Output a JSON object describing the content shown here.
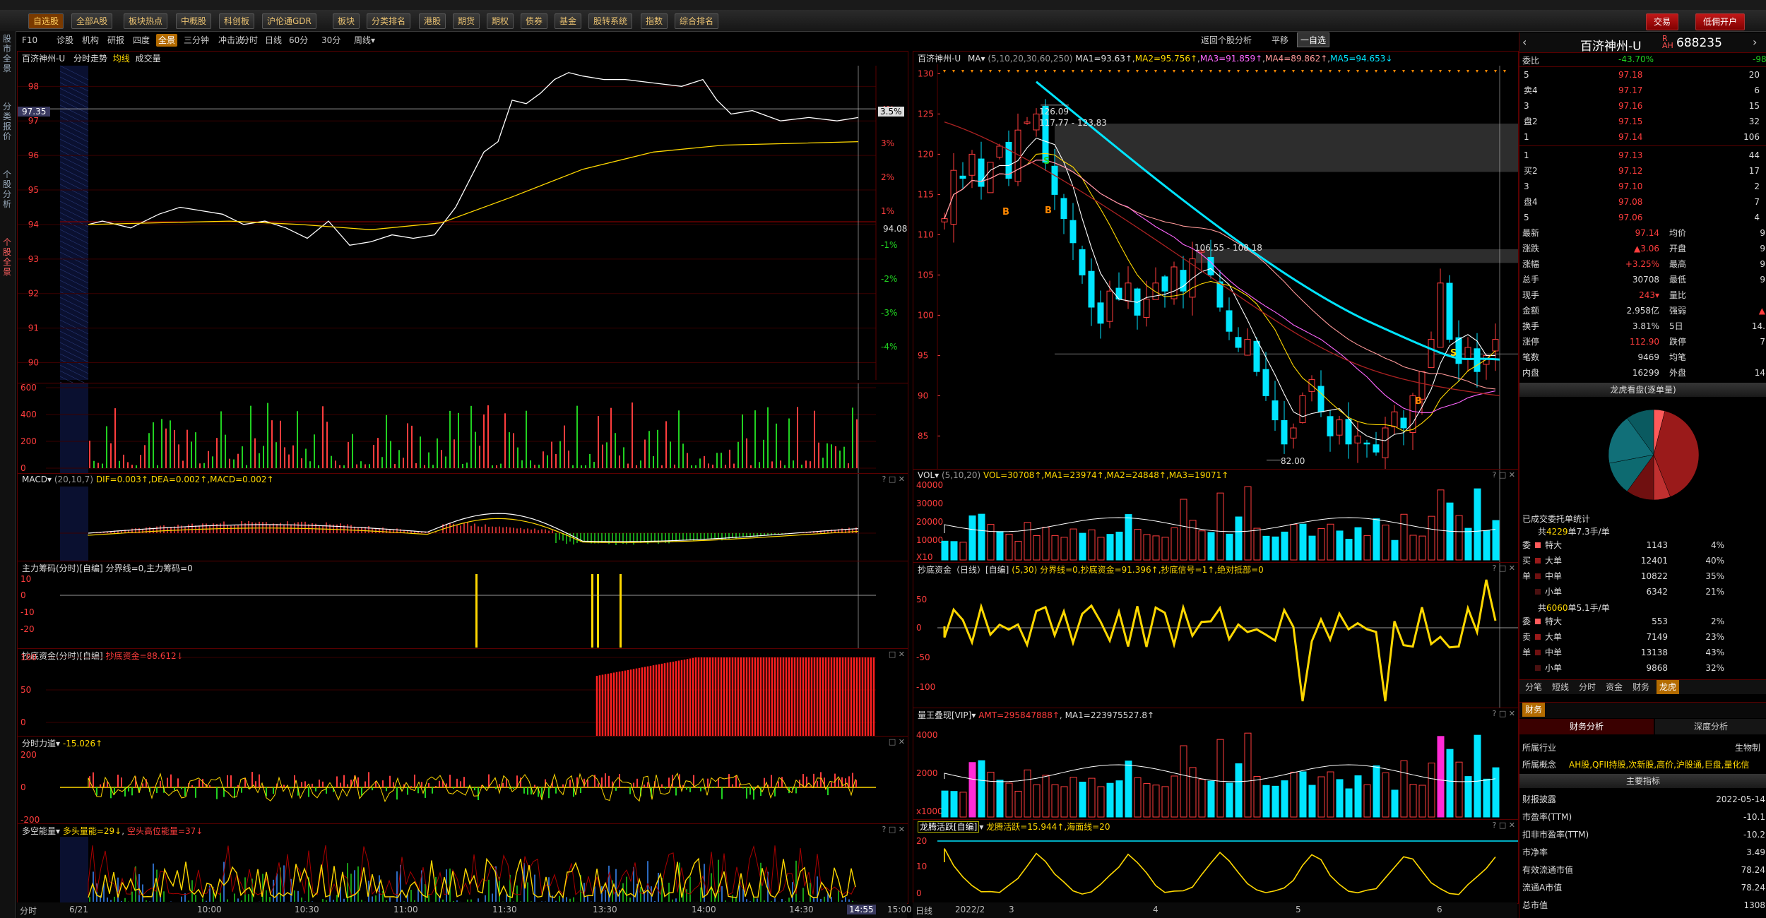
{
  "toolbar": {
    "items": [
      "自选股",
      "全部A股",
      "板块热点",
      "中概股",
      "科创板",
      "沪伦通GDR",
      "板块",
      "分类排名",
      "港股",
      "期货",
      "期权",
      "债券",
      "基金",
      "股转系统",
      "指数",
      "综合排名"
    ],
    "right": [
      "交易",
      "低佣开户"
    ]
  },
  "sidetabs": [
    "股市全景",
    "分类报价",
    "个股分析",
    "个股全景"
  ],
  "subbar": {
    "left": [
      "F10",
      "诊股",
      "机构",
      "研报",
      "四度",
      "全景",
      "三分钟",
      "冲击波"
    ],
    "periods": [
      "分时",
      "日线",
      "60分",
      "30分",
      "周线▾"
    ],
    "right": [
      "返回个股分析",
      "平移",
      "一自选"
    ]
  },
  "intraday": {
    "title": "百济神州-U",
    "title_tabs": [
      "分时走势",
      "均线",
      "成交量"
    ],
    "price_ticks": [
      "98",
      "97",
      "96",
      "95",
      "94",
      "93",
      "92",
      "91",
      "90"
    ],
    "pct_ticks": [
      "4%",
      "3%",
      "2%",
      "1%",
      "-1%",
      "-2%",
      "-3%",
      "-4%"
    ],
    "current_tag": "97.35",
    "pct_tag": "3.5%",
    "prev_close_label": "94.08",
    "vol_ticks": [
      "600",
      "400",
      "200",
      "0"
    ],
    "time_ticks": [
      "6/21",
      "10:00",
      "10:30",
      "11:00",
      "11:30",
      "13:30",
      "14:00",
      "14:30",
      "14:55",
      "15:00"
    ],
    "bottom_tab": "分时"
  },
  "macd": {
    "title": "MACD",
    "params": "(20,10,7)",
    "values": "DIF=0.003↑,DEA=0.002↑,MACD=0.002↑"
  },
  "main_force": {
    "title": "主力筹码(分时)[自编]",
    "values": "分界线=0,主力筹码=0",
    "ticks": [
      "10",
      "0",
      "-10",
      "-20"
    ]
  },
  "bottom_fund_intraday": {
    "title": "抄底资金(分时)[自编]",
    "values": "抄底资金=88.612↓",
    "ticks": [
      "100",
      "50",
      "0"
    ]
  },
  "intraday_force": {
    "title": "分时力道",
    "values": "-15.026↑",
    "ticks": [
      "200",
      "0",
      "-200"
    ]
  },
  "long_short": {
    "title": "多空能量",
    "values_a": "多头量能=29↓",
    "values_b": "空头高位能量=37↓"
  },
  "kline": {
    "title": "百济神州-U",
    "ma_label": "MA",
    "ma_params": "(5,10,20,30,60,250)",
    "ma_values": [
      "MA1=93.63↑",
      "MA2=95.756↑",
      "MA3=91.859↑",
      "MA4=89.862↑",
      "MA5=94.653↓"
    ],
    "price_ticks": [
      "130",
      "125",
      "120",
      "115",
      "110",
      "105",
      "100",
      "95",
      "90",
      "85"
    ],
    "annotations": [
      "126.09",
      "117.77 - 123.83",
      "106.55 - 108.18",
      "82.00"
    ],
    "signal_b": "B",
    "signal_s": "S",
    "x_ticks": [
      "2022/2",
      "3",
      "4",
      "5",
      "6"
    ],
    "bottom_tab": "日线"
  },
  "vol": {
    "title": "VOL",
    "params": "(5,10,20)",
    "values": "VOL=30708↑,MA1=23974↑,MA2=24848↑,MA3=19071↑",
    "ticks": [
      "40000",
      "30000",
      "20000",
      "10000",
      "X10"
    ]
  },
  "bottom_fund_daily": {
    "title": "抄底资金（日线）[自编]",
    "values": "(5,30) 分界线=0,抄底资金=91.396↑,抄底信号=1↑,绝对抵部=0",
    "ticks": [
      "50",
      "0",
      "-50",
      "-100"
    ]
  },
  "volume_king": {
    "title": "量王叠现[VIP]",
    "values_a": "AMT=295847888↑",
    "values_b": "MA1=223975527.8↑",
    "ticks": [
      "4000",
      "2000",
      "x10000"
    ]
  },
  "dragon": {
    "title": "龙腾活跃[自编]",
    "values": "龙腾活跃=15.944↑,海面线=20",
    "ticks": [
      "20",
      "10",
      "0"
    ]
  },
  "quote": {
    "name": "百济神州-U",
    "code": "688235",
    "weibi_label": "委比",
    "weibi": "-43.70%",
    "weicha": "-98",
    "sells": [
      {
        "label": "5",
        "price": "97.18",
        "vol": "20"
      },
      {
        "label": "卖4",
        "price": "97.17",
        "vol": "6"
      },
      {
        "label": "3",
        "price": "97.16",
        "vol": "15"
      },
      {
        "label": "盘2",
        "price": "97.15",
        "vol": "32"
      },
      {
        "label": "1",
        "price": "97.14",
        "vol": "106"
      }
    ],
    "buys": [
      {
        "label": "1",
        "price": "97.13",
        "vol": "44"
      },
      {
        "label": "买2",
        "price": "97.12",
        "vol": "17"
      },
      {
        "label": "3",
        "price": "97.10",
        "vol": "2"
      },
      {
        "label": "盘4",
        "price": "97.08",
        "vol": "7"
      },
      {
        "label": "5",
        "price": "97.06",
        "vol": "4"
      }
    ],
    "stats": [
      {
        "k": "最新",
        "v": "97.14",
        "k2": "均价",
        "v2": "9"
      },
      {
        "k": "涨跌",
        "v": "▲3.06",
        "k2": "开盘",
        "v2": "9"
      },
      {
        "k": "涨幅",
        "v": "+3.25%",
        "k2": "最高",
        "v2": "9"
      },
      {
        "k": "总手",
        "v": "30708",
        "k2": "最低",
        "v2": "9"
      },
      {
        "k": "现手",
        "v": "243▾",
        "k2": "量比",
        "v2": ""
      },
      {
        "k": "金额",
        "v": "2.958亿",
        "k2": "强弱",
        "v2": "▲"
      },
      {
        "k": "换手",
        "v": "3.81%",
        "k2": "5日",
        "v2": "14."
      },
      {
        "k": "涨停",
        "v": "112.90",
        "k2": "跌停",
        "v2": "7"
      },
      {
        "k": "笔数",
        "v": "9469",
        "k2": "均笔",
        "v2": ""
      },
      {
        "k": "内盘",
        "v": "16299",
        "k2": "外盘",
        "v2": "14"
      }
    ],
    "pie_title": "龙虎看盘(逐单量)",
    "orders_title": "已成交委托单统计",
    "buy_summary": {
      "prefix": "共",
      "count": "4229",
      "suffix": "单7.3手/单"
    },
    "buy_rows": [
      {
        "side": "委",
        "type": "特大",
        "vol": "1143",
        "pct": "4%"
      },
      {
        "side": "买",
        "type": "大单",
        "vol": "12401",
        "pct": "40%"
      },
      {
        "side": "单",
        "type": "中单",
        "vol": "10822",
        "pct": "35%"
      },
      {
        "side": "",
        "type": "小单",
        "vol": "6342",
        "pct": "21%"
      }
    ],
    "sell_summary": {
      "prefix": "共",
      "count": "6060",
      "suffix": "单5.1手/单"
    },
    "sell_rows": [
      {
        "side": "委",
        "type": "特大",
        "vol": "553",
        "pct": "2%"
      },
      {
        "side": "卖",
        "type": "大单",
        "vol": "7149",
        "pct": "23%"
      },
      {
        "side": "单",
        "type": "中单",
        "vol": "13138",
        "pct": "43%"
      },
      {
        "side": "",
        "type": "小单",
        "vol": "9868",
        "pct": "32%"
      }
    ],
    "tabs": [
      "分笔",
      "短线",
      "分时",
      "资金",
      "财务",
      "龙虎"
    ],
    "fin_tab": "财务",
    "fin_sub": [
      "财务分析",
      "深度分析"
    ],
    "industry_label": "所属行业",
    "industry": "生物制",
    "concept_label": "所属概念",
    "concept": "AH股,QFII持股,次新股,高价,沪股通,巨盘,量化信",
    "main_index": "主要指标",
    "fin_rows": [
      {
        "k": "财报披露",
        "v": "2022-05-14"
      },
      {
        "k": "市盈率(TTM)",
        "v": "-10.1"
      },
      {
        "k": "扣非市盈率(TTM)",
        "v": "-10.2"
      },
      {
        "k": "市净率",
        "v": "3.49"
      },
      {
        "k": "有效流通市值",
        "v": "78.24"
      },
      {
        "k": "流通A市值",
        "v": "78.24"
      },
      {
        "k": "总市值",
        "v": "1308"
      }
    ]
  },
  "colors": {
    "up": "#ff3d3d",
    "down": "#21d121",
    "cyan": "#00e5ff",
    "yellow": "#ffd800",
    "magenta": "#ff2bd6",
    "border": "#5a0000"
  }
}
